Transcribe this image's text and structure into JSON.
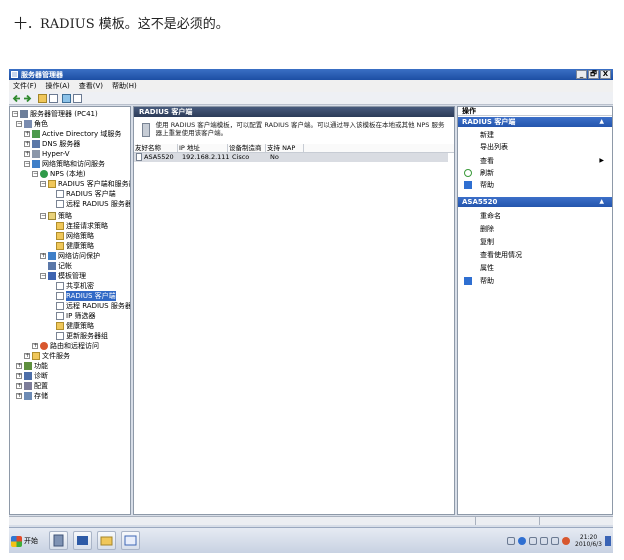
{
  "caption": "十．RADIUS 模板。这不是必须的。",
  "window": {
    "title": "服务器管理器",
    "buttons": [
      "_",
      "🗗",
      "X"
    ]
  },
  "menu": [
    "文件(F)",
    "操作(A)",
    "查看(V)",
    "帮助(H)"
  ],
  "tree": [
    {
      "label": "服务器管理器 (PC41)",
      "expander": "−",
      "icon": "server-icon"
    },
    {
      "label": "角色",
      "expander": "−",
      "icon": "roles-icon"
    },
    {
      "label": "Active Directory 域服务",
      "expander": "+",
      "icon": "active-directory-icon"
    },
    {
      "label": "DNS 服务器",
      "expander": "+",
      "icon": "dns-icon"
    },
    {
      "label": "Hyper-V",
      "expander": "+",
      "icon": "hyper-v-icon"
    },
    {
      "label": "网络策略和访问服务",
      "expander": "−",
      "icon": "network-policy-icon"
    },
    {
      "label": "NPS (本地)",
      "expander": "−",
      "icon": "nps-icon"
    },
    {
      "label": "RADIUS 客户端和服务器",
      "expander": "−",
      "icon": "folder-icon"
    },
    {
      "label": "RADIUS 客户端",
      "expander": "",
      "icon": "document-icon"
    },
    {
      "label": "远程 RADIUS 服务器组",
      "expander": "",
      "icon": "document-icon"
    },
    {
      "label": "策略",
      "expander": "−",
      "icon": "policy-folder-icon"
    },
    {
      "label": "连接请求策略",
      "expander": "",
      "icon": "folder-icon"
    },
    {
      "label": "网络策略",
      "expander": "",
      "icon": "folder-icon"
    },
    {
      "label": "健康策略",
      "expander": "",
      "icon": "folder-icon"
    },
    {
      "label": "网络访问保护",
      "expander": "+",
      "icon": "nap-icon"
    },
    {
      "label": "记帐",
      "expander": "",
      "icon": "accounting-icon"
    },
    {
      "label": "模板管理",
      "expander": "−",
      "icon": "template-icon"
    },
    {
      "label": "共享机密",
      "expander": "",
      "icon": "document-icon"
    },
    {
      "label": "RADIUS 客户端",
      "expander": "",
      "icon": "document-icon",
      "selected": true
    },
    {
      "label": "远程 RADIUS 服务器",
      "expander": "",
      "icon": "document-icon"
    },
    {
      "label": "IP 筛选器",
      "expander": "",
      "icon": "document-icon"
    },
    {
      "label": "健康策略",
      "expander": "",
      "icon": "folder-icon"
    },
    {
      "label": "更新服务器组",
      "expander": "",
      "icon": "document-icon"
    },
    {
      "label": "路由和远程访问",
      "expander": "+",
      "icon": "routing-icon"
    },
    {
      "label": "文件服务",
      "expander": "+",
      "icon": "file-services-icon"
    },
    {
      "label": "功能",
      "expander": "+",
      "icon": "features-icon"
    },
    {
      "label": "诊断",
      "expander": "+",
      "icon": "diagnostics-icon"
    },
    {
      "label": "配置",
      "expander": "+",
      "icon": "configuration-icon"
    },
    {
      "label": "存储",
      "expander": "+",
      "icon": "storage-icon"
    }
  ],
  "center": {
    "header": "RADIUS 客户端",
    "description": "使用 RADIUS 客户端模板，可以配置 RADIUS 客户端。可以通过导入该模板在本地或其他 NPS 服务器上重复使用该客户端。",
    "columns": [
      "友好名称",
      "IP 地址",
      "设备制造商",
      "支持 NAP"
    ],
    "rows": [
      [
        "ASA5520",
        "192.168.2.111",
        "Cisco",
        "No"
      ]
    ]
  },
  "actions": {
    "title": "操作",
    "section1": {
      "title": "RADIUS 客户端",
      "items": [
        {
          "label": "新建",
          "icon": ""
        },
        {
          "label": "导出列表",
          "icon": ""
        },
        {
          "label": "查看",
          "icon": "",
          "submenu": true
        },
        {
          "label": "刷新",
          "icon": "refresh-icon"
        },
        {
          "label": "帮助",
          "icon": "help-icon"
        }
      ]
    },
    "section2": {
      "title": "ASA5520",
      "items": [
        {
          "label": "重命名",
          "icon": ""
        },
        {
          "label": "删除",
          "icon": ""
        },
        {
          "label": "复制",
          "icon": ""
        },
        {
          "label": "查看使用情况",
          "icon": ""
        },
        {
          "label": "属性",
          "icon": ""
        },
        {
          "label": "帮助",
          "icon": "help-icon"
        }
      ]
    }
  },
  "taskbar": {
    "start": "开始",
    "time": "21:20",
    "date": "2010/6/3"
  },
  "colors": {
    "titlebar": "#1d4ea3",
    "selection": "#3169c6",
    "section": "#2455ad"
  }
}
